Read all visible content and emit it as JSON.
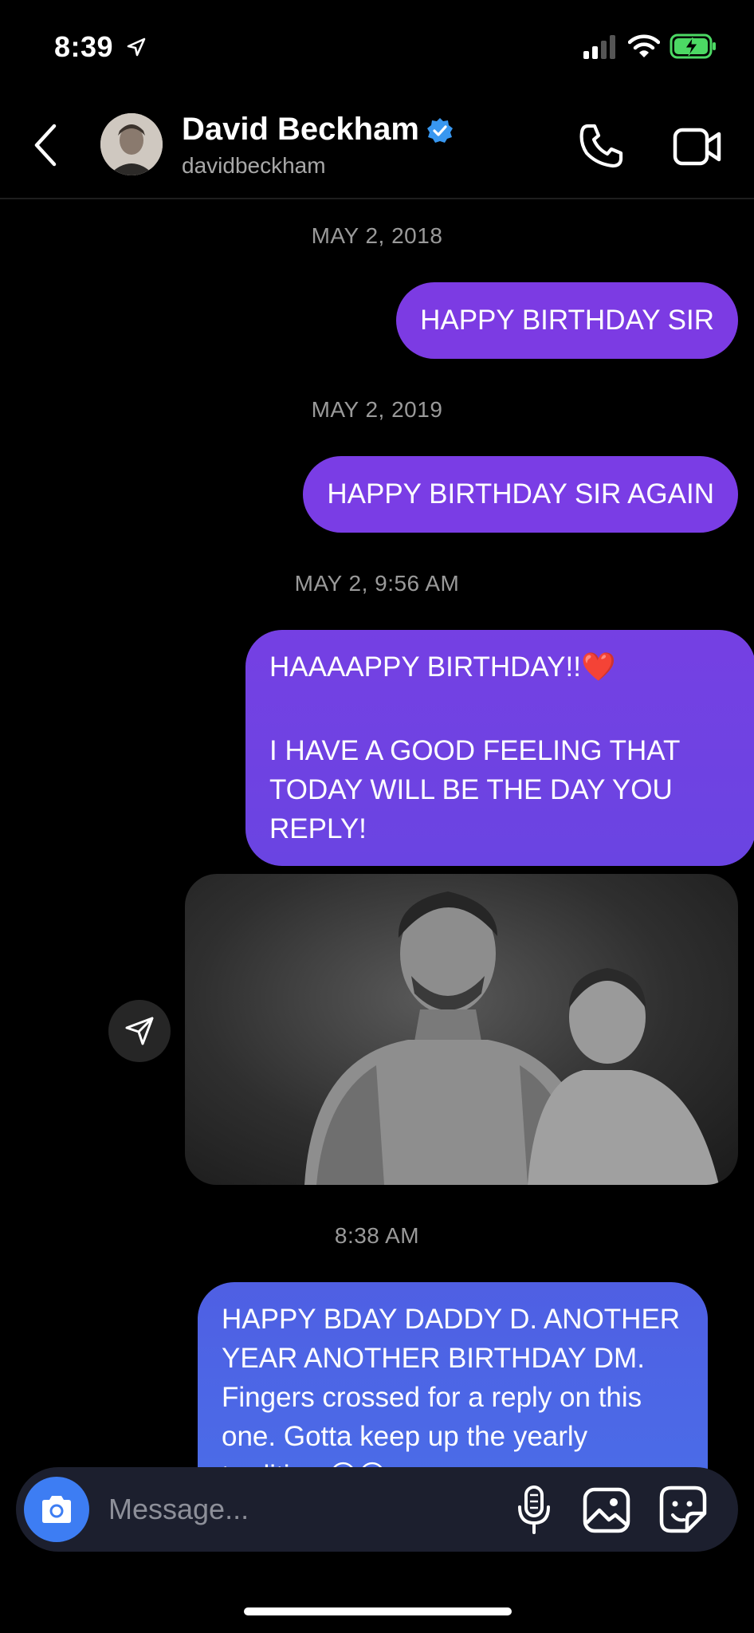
{
  "status_bar": {
    "time": "8:39",
    "icons": [
      "location-arrow-icon",
      "signal-icon",
      "wifi-icon",
      "battery-charging-icon"
    ]
  },
  "header": {
    "name": "David Beckham",
    "username": "davidbeckham",
    "verified": true,
    "icons": [
      "back-chevron-icon",
      "phone-icon",
      "video-camera-icon"
    ]
  },
  "messages": [
    {
      "date": "MAY 2, 2018",
      "text": "HAPPY BIRTHDAY SIR"
    },
    {
      "date": "MAY 2, 2019",
      "text": "HAPPY BIRTHDAY SIR AGAIN"
    },
    {
      "date": "MAY 2, 9:56 AM",
      "line1": "HAAAAPPY BIRTHDAY!!❤️",
      "line2": "I HAVE A GOOD FEELING THAT TODAY WILL BE THE DAY YOU REPLY!"
    },
    {
      "date": "8:38 AM",
      "text": "HAPPY BDAY DADDY D. ANOTHER YEAR ANOTHER BIRTHDAY DM. Fingers crossed for a reply on this one. Gotta keep up the yearly tradition 😃😃"
    }
  ],
  "composer": {
    "placeholder": "Message...",
    "icons": [
      "camera-icon",
      "microphone-icon",
      "gallery-icon",
      "sticker-icon"
    ]
  },
  "colors": {
    "background": "#000000",
    "bubble_purple": "#7c3be3",
    "bubble_blue": "#4f5fe3",
    "verified_blue": "#3897f0",
    "camera_button": "#3d7df3"
  }
}
